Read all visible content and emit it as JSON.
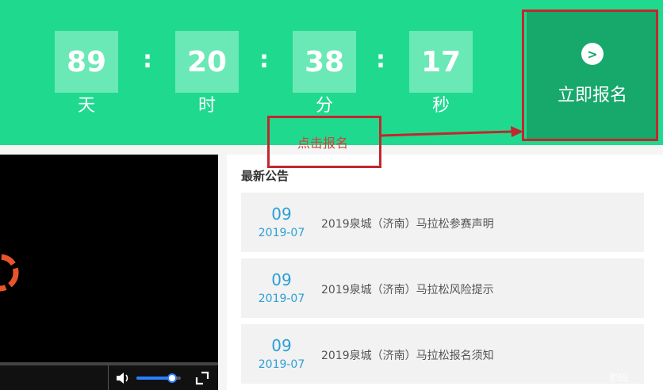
{
  "countdown": {
    "units": [
      {
        "value": "89",
        "label": "天"
      },
      {
        "value": "20",
        "label": "时"
      },
      {
        "value": "38",
        "label": "分"
      },
      {
        "value": "17",
        "label": "秒"
      }
    ],
    "separator": ":"
  },
  "register_button": {
    "label": "立即报名",
    "icon": "arrow-right-circle-icon"
  },
  "annotation": {
    "text": "点击报名",
    "color": "#c1272d"
  },
  "video_player": {
    "volume_percent": 80,
    "icons": [
      "loading-spinner-icon",
      "volume-icon",
      "fullscreen-icon"
    ]
  },
  "notices": {
    "heading": "最新公告",
    "items": [
      {
        "day": "09",
        "year_month": "2019-07",
        "title": "2019泉城（济南）马拉松参赛声明"
      },
      {
        "day": "09",
        "year_month": "2019-07",
        "title": "2019泉城（济南）马拉松风险提示"
      },
      {
        "day": "09",
        "year_month": "2019-07",
        "title": "2019泉城（济南）马拉松报名须知"
      }
    ]
  },
  "watermark": "影码",
  "colors": {
    "banner": "#1fda8e",
    "register": "#17a86c",
    "accent_blue": "#2b9fd6"
  }
}
